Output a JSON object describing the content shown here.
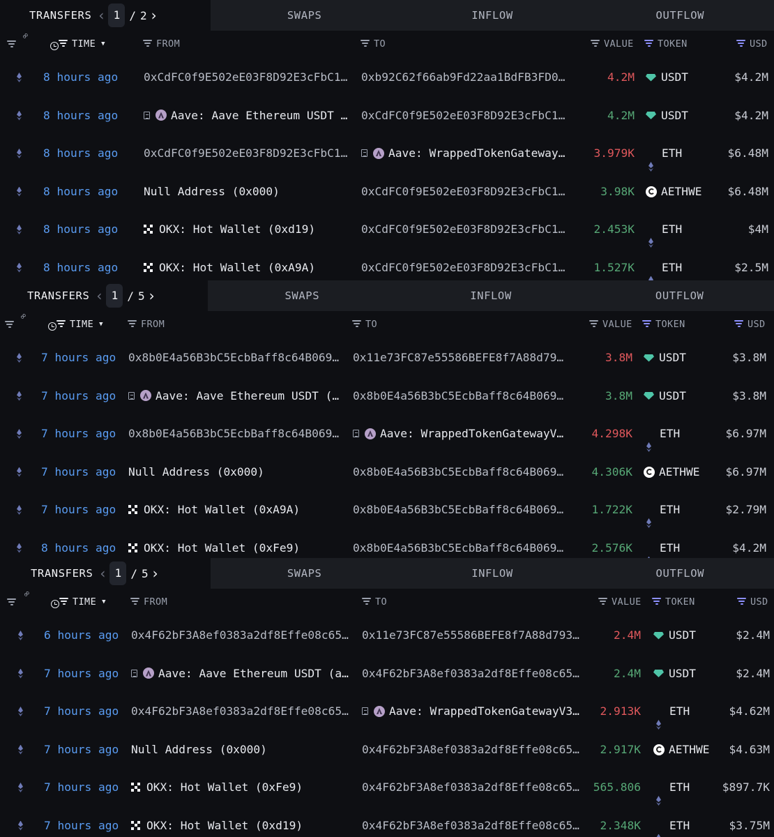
{
  "tabs": {
    "transfers": "TRANSFERS",
    "swaps": "SWAPS",
    "inflow": "INFLOW",
    "outflow": "OUTFLOW"
  },
  "headers": {
    "time": "TIME",
    "from": "FROM",
    "to": "TO",
    "value": "VALUE",
    "token": "TOKEN",
    "usd": "USD"
  },
  "colors": {
    "inflow_value": "#57a876",
    "outflow_value": "#e0585c",
    "time_link": "#5a9cf2",
    "accent_filter": "#8d90ff"
  },
  "panels": [
    {
      "page": "1",
      "pages": "2",
      "rows": [
        {
          "time": "8 hours ago",
          "from": "0xCdFC0f9E502eE03F8D92E3cFbC1…",
          "to": "0xb92C62f66ab9Fd22aa1BdFB3FD0…",
          "value": "4.2M",
          "dir": "out",
          "token": "USDT",
          "token_icon": "usdt-icon",
          "usd": "$4.2M"
        },
        {
          "time": "8 hours ago",
          "from": "Aave: Aave Ethereum USDT …",
          "from_icon": "aave",
          "to": "0xCdFC0f9E502eE03F8D92E3cFbC1…",
          "value": "4.2M",
          "dir": "in",
          "token": "USDT",
          "token_icon": "usdt-icon",
          "usd": "$4.2M"
        },
        {
          "time": "8 hours ago",
          "from": "0xCdFC0f9E502eE03F8D92E3cFbC1…",
          "to": "Aave: WrappedTokenGateway…",
          "to_icon": "aave",
          "value": "3.979K",
          "dir": "out",
          "token": "ETH",
          "token_icon": "eth-icon",
          "usd": "$6.48M"
        },
        {
          "time": "8 hours ago",
          "from": "Null Address (0x000)",
          "from_icon": "named",
          "to": "0xCdFC0f9E502eE03F8D92E3cFbC1…",
          "value": "3.98K",
          "dir": "in",
          "token": "AETHWE",
          "token_icon": "aethwe-icon",
          "usd": "$6.48M"
        },
        {
          "time": "8 hours ago",
          "from": "OKX: Hot Wallet (0xd19)",
          "from_icon": "okx",
          "to": "0xCdFC0f9E502eE03F8D92E3cFbC1…",
          "value": "2.453K",
          "dir": "in",
          "token": "ETH",
          "token_icon": "eth-icon",
          "usd": "$4M"
        },
        {
          "time": "8 hours ago",
          "from": "OKX: Hot Wallet (0xA9A)",
          "from_icon": "okx",
          "to": "0xCdFC0f9E502eE03F8D92E3cFbC1…",
          "value": "1.527K",
          "dir": "in",
          "token": "ETH",
          "token_icon": "eth-icon",
          "usd": "$2.5M"
        }
      ]
    },
    {
      "page": "1",
      "pages": "5",
      "rows": [
        {
          "time": "7 hours ago",
          "from": "0x8b0E4a56B3bC5EcbBaff8c64B069…",
          "to": "0x11e73FC87e55586BEFE8f7A88d79…",
          "value": "3.8M",
          "dir": "out",
          "token": "USDT",
          "token_icon": "usdt-icon",
          "usd": "$3.8M"
        },
        {
          "time": "7 hours ago",
          "from": "Aave: Aave Ethereum USDT (…",
          "from_icon": "aave",
          "to": "0x8b0E4a56B3bC5EcbBaff8c64B069…",
          "value": "3.8M",
          "dir": "in",
          "token": "USDT",
          "token_icon": "usdt-icon",
          "usd": "$3.8M"
        },
        {
          "time": "7 hours ago",
          "from": "0x8b0E4a56B3bC5EcbBaff8c64B069…",
          "to": "Aave: WrappedTokenGatewayV…",
          "to_icon": "aave",
          "value": "4.298K",
          "dir": "out",
          "token": "ETH",
          "token_icon": "eth-icon",
          "usd": "$6.97M"
        },
        {
          "time": "7 hours ago",
          "from": "Null Address (0x000)",
          "from_icon": "named",
          "to": "0x8b0E4a56B3bC5EcbBaff8c64B069…",
          "value": "4.306K",
          "dir": "in",
          "token": "AETHWE",
          "token_icon": "aethwe-icon",
          "usd": "$6.97M"
        },
        {
          "time": "7 hours ago",
          "from": "OKX: Hot Wallet (0xA9A)",
          "from_icon": "okx",
          "to": "0x8b0E4a56B3bC5EcbBaff8c64B069…",
          "value": "1.722K",
          "dir": "in",
          "token": "ETH",
          "token_icon": "eth-icon",
          "usd": "$2.79M"
        },
        {
          "time": "8 hours ago",
          "from": "OKX: Hot Wallet (0xFe9)",
          "from_icon": "okx",
          "to": "0x8b0E4a56B3bC5EcbBaff8c64B069…",
          "value": "2.576K",
          "dir": "in",
          "token": "ETH",
          "token_icon": "eth-icon",
          "usd": "$4.2M"
        }
      ]
    },
    {
      "page": "1",
      "pages": "5",
      "rows": [
        {
          "time": "6 hours ago",
          "from": "0x4F62bF3A8ef0383a2df8Effe08c65…",
          "to": "0x11e73FC87e55586BEFE8f7A88d793…",
          "value": "2.4M",
          "dir": "out",
          "token": "USDT",
          "token_icon": "usdt-icon",
          "usd": "$2.4M"
        },
        {
          "time": "7 hours ago",
          "from": "Aave: Aave Ethereum USDT (a…",
          "from_icon": "aave",
          "to": "0x4F62bF3A8ef0383a2df8Effe08c65…",
          "value": "2.4M",
          "dir": "in",
          "token": "USDT",
          "token_icon": "usdt-icon",
          "usd": "$2.4M"
        },
        {
          "time": "7 hours ago",
          "from": "0x4F62bF3A8ef0383a2df8Effe08c65…",
          "to": "Aave: WrappedTokenGatewayV3…",
          "to_icon": "aave",
          "value": "2.913K",
          "dir": "out",
          "token": "ETH",
          "token_icon": "eth-icon",
          "usd": "$4.62M"
        },
        {
          "time": "7 hours ago",
          "from": "Null Address (0x000)",
          "from_icon": "named",
          "to": "0x4F62bF3A8ef0383a2df8Effe08c65…",
          "value": "2.917K",
          "dir": "in",
          "token": "AETHWE",
          "token_icon": "aethwe-icon",
          "usd": "$4.63M"
        },
        {
          "time": "7 hours ago",
          "from": "OKX: Hot Wallet (0xFe9)",
          "from_icon": "okx",
          "to": "0x4F62bF3A8ef0383a2df8Effe08c65…",
          "value": "565.806",
          "dir": "in",
          "token": "ETH",
          "token_icon": "eth-icon",
          "usd": "$897.7K"
        },
        {
          "time": "7 hours ago",
          "from": "OKX: Hot Wallet (0xd19)",
          "from_icon": "okx",
          "to": "0x4F62bF3A8ef0383a2df8Effe08c65…",
          "value": "2.348K",
          "dir": "in",
          "token": "ETH",
          "token_icon": "eth-icon",
          "usd": "$3.75M"
        }
      ]
    }
  ]
}
